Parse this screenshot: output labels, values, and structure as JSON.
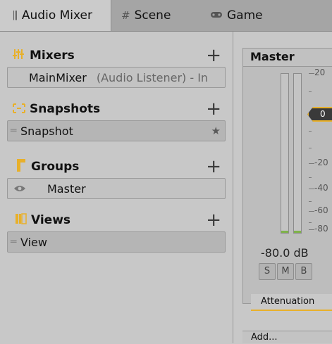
{
  "tabs": {
    "audio_mixer": "Audio Mixer",
    "scene": "Scene",
    "game": "Game"
  },
  "sections": {
    "mixers": {
      "title": "Mixers",
      "item_name": "MainMixer",
      "item_note": "(Audio Listener) - In"
    },
    "snapshots": {
      "title": "Snapshots",
      "item": "Snapshot"
    },
    "groups": {
      "title": "Groups",
      "item": "Master"
    },
    "views": {
      "title": "Views",
      "item": "View"
    }
  },
  "strip": {
    "title": "Master",
    "fader_value": "0",
    "level_readout": "-80.0 dB",
    "solo": "S",
    "mute": "M",
    "bypass": "B",
    "effect": "Attenuation",
    "add_label": "Add...",
    "scale_labels": [
      "20",
      "-20",
      "-40",
      "-60",
      "-80"
    ]
  },
  "colors": {
    "accent": "#e8b02a",
    "meter_floor": "#7fb24a",
    "panel_bg": "#c8c8c8",
    "tabbar_bg": "#a5a5a5"
  }
}
